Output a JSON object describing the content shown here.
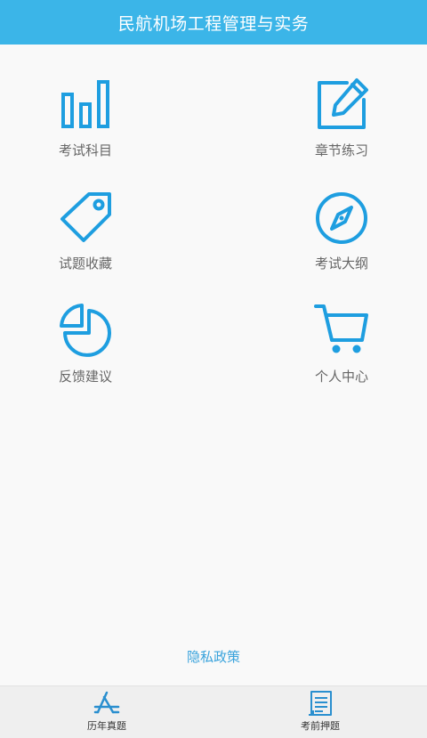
{
  "header": {
    "title": "民航机场工程管理与实务"
  },
  "menu": {
    "items": [
      {
        "label": "考试科目",
        "icon": "bar-chart-icon"
      },
      {
        "label": "章节练习",
        "icon": "edit-icon"
      },
      {
        "label": "试题收藏",
        "icon": "tag-icon"
      },
      {
        "label": "考试大纲",
        "icon": "compass-icon"
      },
      {
        "label": "反馈建议",
        "icon": "pie-chart-icon"
      },
      {
        "label": "个人中心",
        "icon": "cart-icon"
      }
    ]
  },
  "privacy": {
    "label": "隐私政策"
  },
  "tabbar": {
    "tabs": [
      {
        "label": "历年真题",
        "icon": "app-store-icon"
      },
      {
        "label": "考前押题",
        "icon": "document-icon"
      }
    ]
  },
  "colors": {
    "header_bg": "#3bb5e8",
    "icon": "#1e9ee0",
    "link": "#3aa3dc"
  }
}
